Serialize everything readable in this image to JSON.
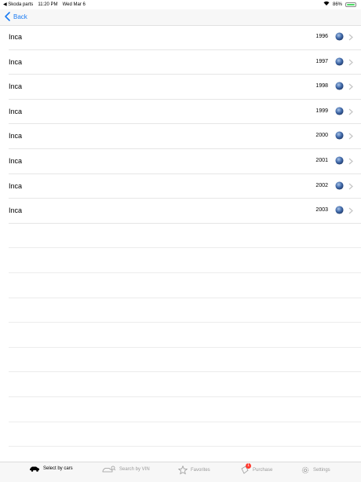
{
  "status_bar": {
    "back_app": "◀ Skoda parts",
    "time": "11:20 PM",
    "date": "Wed Mar 6",
    "battery": "86%"
  },
  "nav": {
    "back_label": "Back"
  },
  "rows": [
    {
      "model": "Inca",
      "year": "1996"
    },
    {
      "model": "Inca",
      "year": "1997"
    },
    {
      "model": "Inca",
      "year": "1998"
    },
    {
      "model": "Inca",
      "year": "1999"
    },
    {
      "model": "Inca",
      "year": "2000"
    },
    {
      "model": "Inca",
      "year": "2001"
    },
    {
      "model": "Inca",
      "year": "2002"
    },
    {
      "model": "Inca",
      "year": "2003"
    }
  ],
  "tab_bar": {
    "tabs": [
      {
        "label": "Select by cars",
        "icon": "car-icon",
        "active": true
      },
      {
        "label": "Search by VIN",
        "icon": "vin-search-icon",
        "active": false
      },
      {
        "label": "Favorites",
        "icon": "star-icon",
        "active": false
      },
      {
        "label": "Purchase",
        "icon": "purchase-icon",
        "active": false,
        "badge": "1"
      },
      {
        "label": "Settings",
        "icon": "gear-icon",
        "active": false
      }
    ]
  },
  "colors": {
    "accent": "#1b7cf3",
    "badge": "#ff3b30",
    "battery": "#4cd964"
  }
}
